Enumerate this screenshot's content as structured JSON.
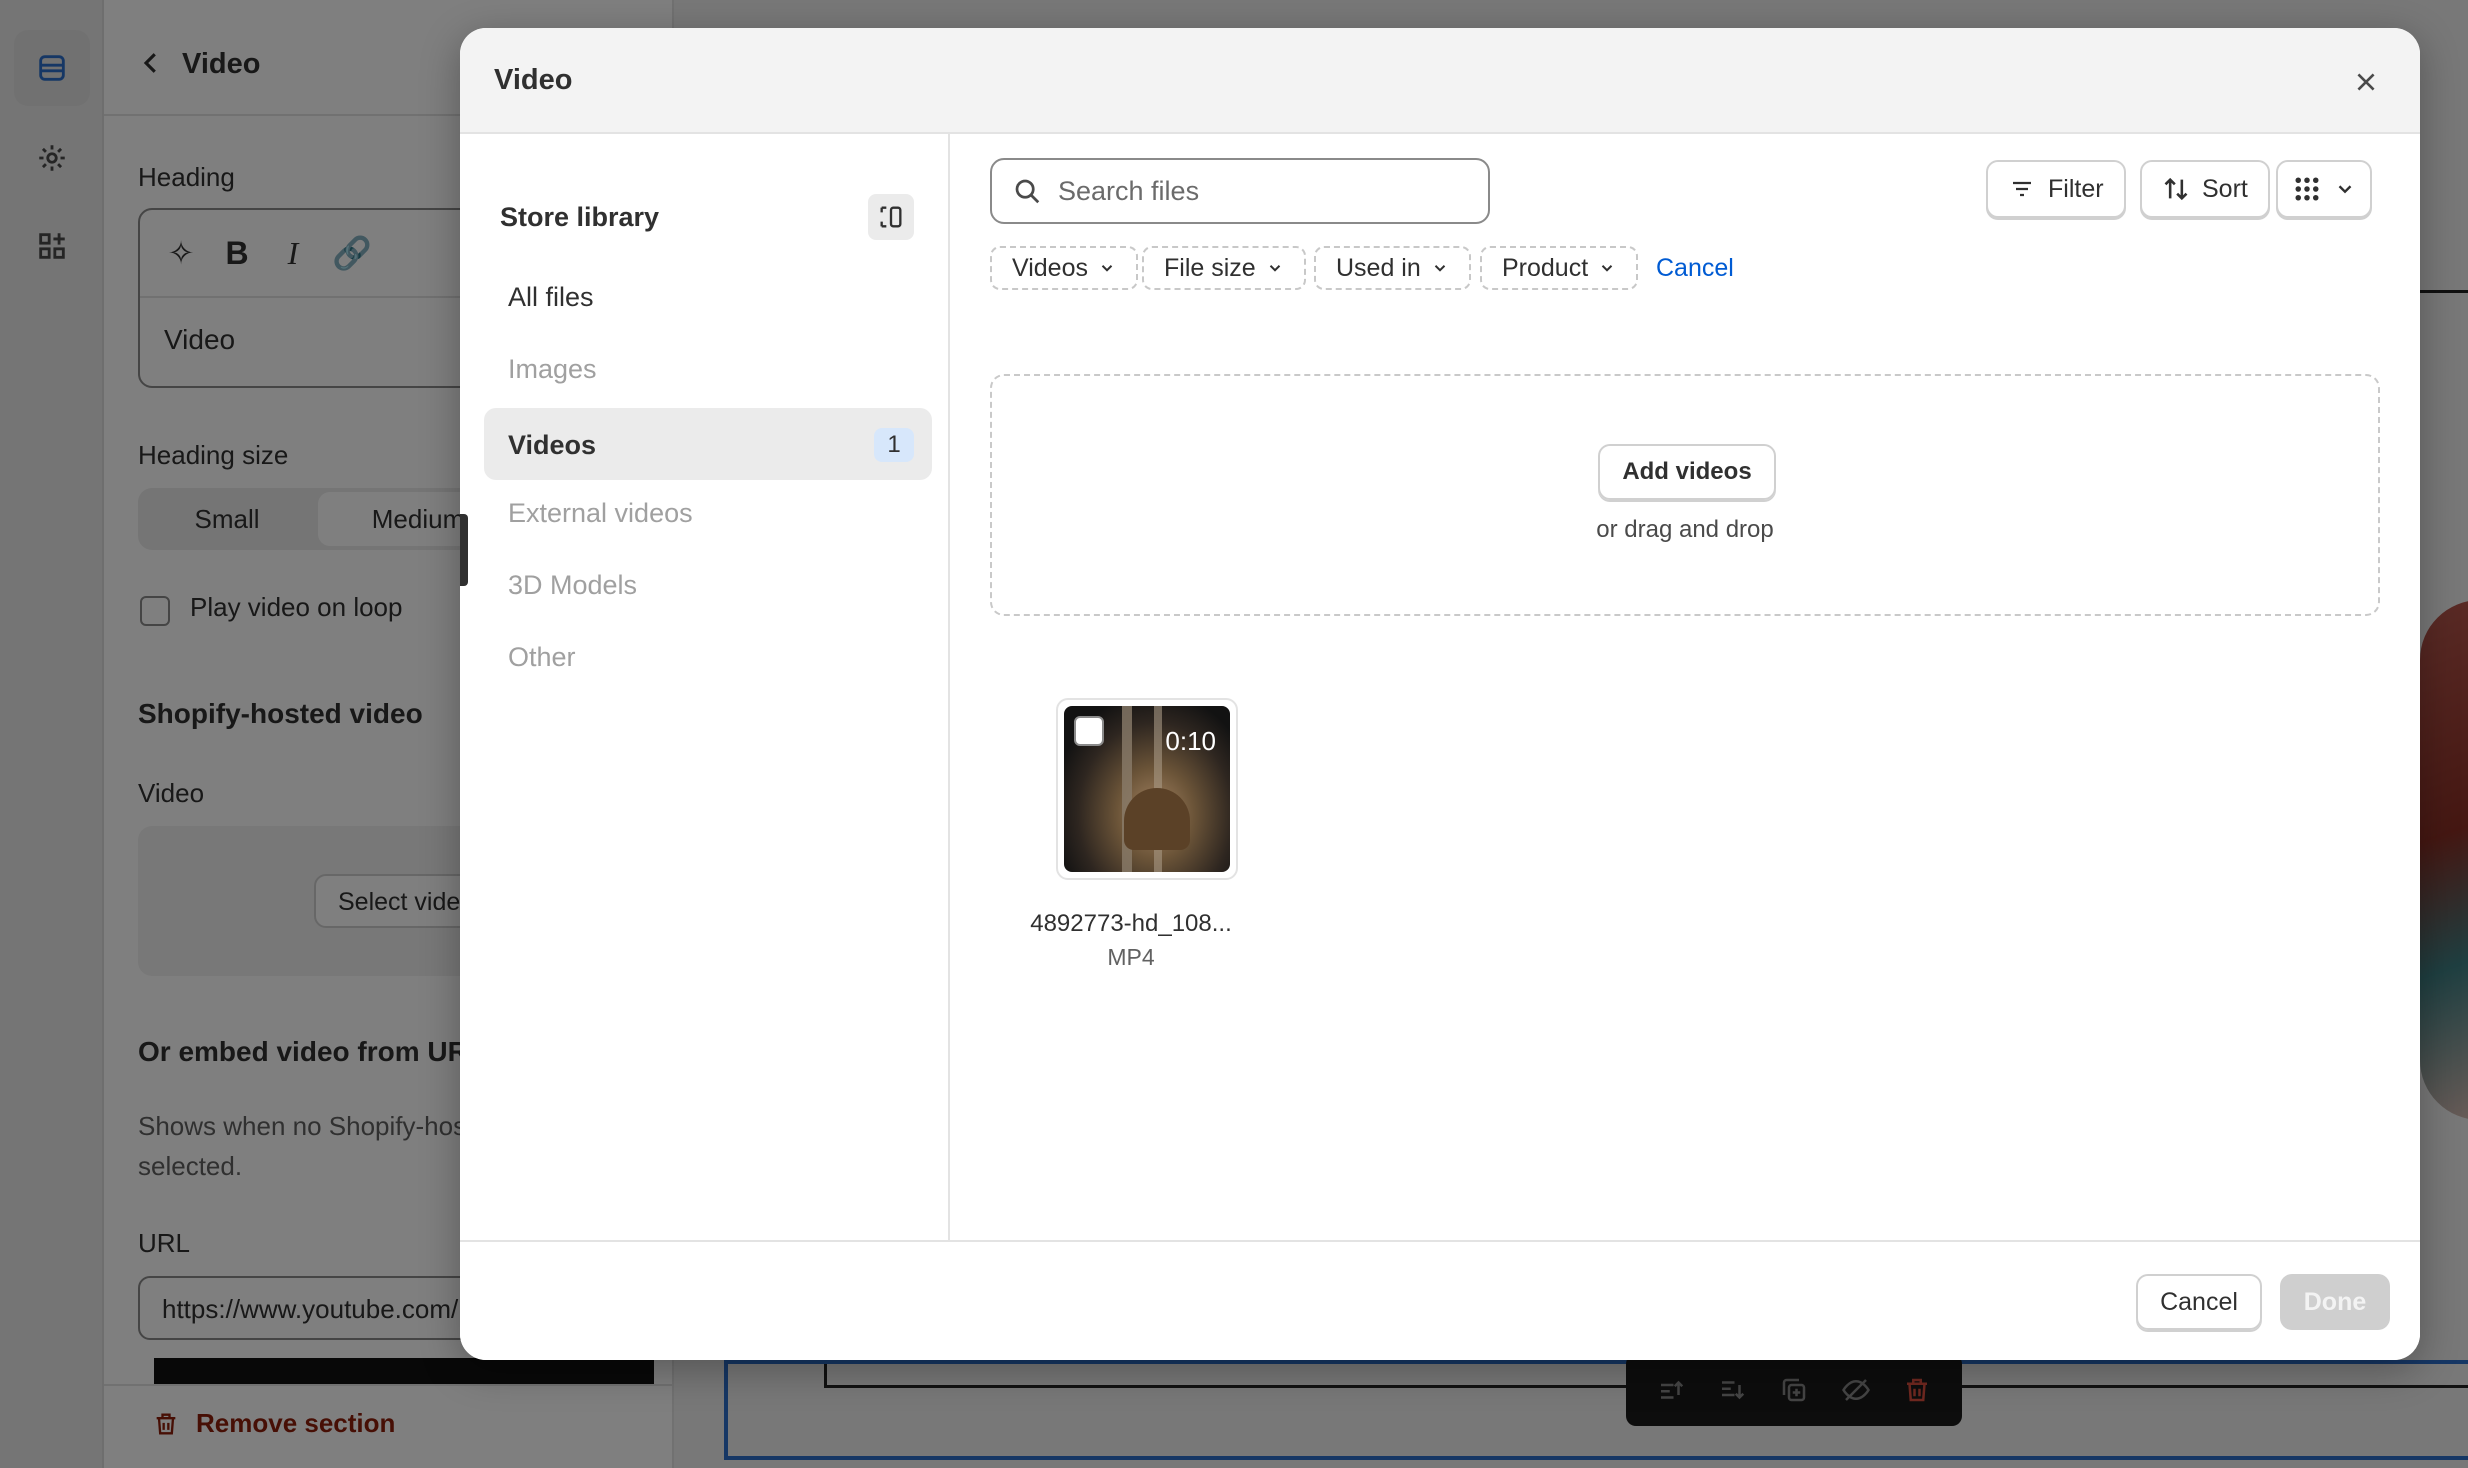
{
  "editor": {
    "panel_title": "Video",
    "heading_label": "Heading",
    "heading_value": "Video",
    "heading_size_label": "Heading size",
    "size_options": [
      "Small",
      "Medium"
    ],
    "loop_label": "Play video on loop",
    "hosted_title": "Shopify-hosted video",
    "video_label": "Video",
    "select_video_label": "Select video",
    "embed_title": "Or embed video from URL",
    "embed_help": "Shows when no Shopify-hosted video is selected.",
    "url_label": "URL",
    "url_value": "https://www.youtube.com/",
    "remove_section": "Remove section"
  },
  "modal": {
    "title": "Video",
    "library_title": "Store library",
    "nav": [
      {
        "label": "All files"
      },
      {
        "label": "Images"
      },
      {
        "label": "Videos",
        "count": "1"
      },
      {
        "label": "External videos"
      },
      {
        "label": "3D Models"
      },
      {
        "label": "Other"
      }
    ],
    "search_placeholder": "Search files",
    "filter_label": "Filter",
    "sort_label": "Sort",
    "chips": [
      "Videos",
      "File size",
      "Used in",
      "Product"
    ],
    "chips_cancel": "Cancel",
    "add_videos": "Add videos",
    "drag_text": "or drag and drop",
    "files": [
      {
        "name": "4892773-hd_108...",
        "type": "MP4",
        "duration": "0:10"
      }
    ],
    "cancel_label": "Cancel",
    "done_label": "Done"
  }
}
